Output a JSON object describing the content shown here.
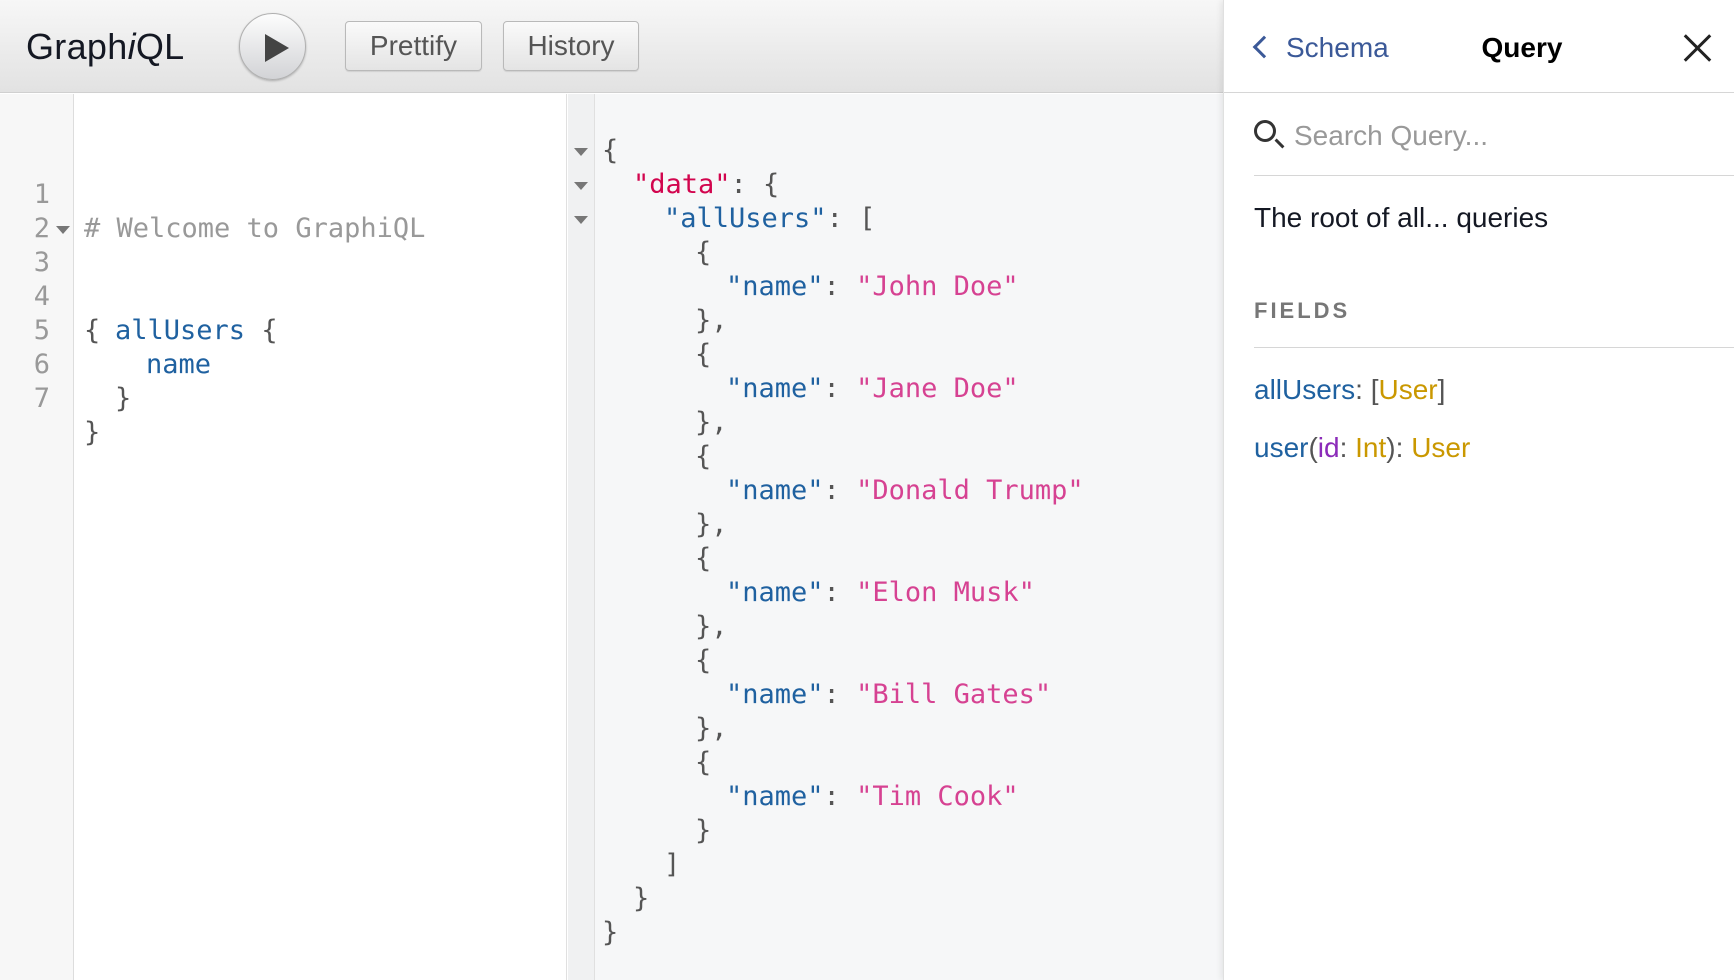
{
  "toolbar": {
    "title_prefix": "Graph",
    "title_italic": "i",
    "title_suffix": "QL",
    "run_icon": "play-icon",
    "prettify_label": "Prettify",
    "history_label": "History"
  },
  "query_editor": {
    "lines": [
      {
        "num": "1",
        "comment": "# Welcome to GraphiQL"
      },
      {
        "num": "2"
      },
      {
        "num": "3",
        "punct": "{"
      },
      {
        "num": "4",
        "field": "allUsers",
        "punct": "{"
      },
      {
        "num": "5",
        "field": "name"
      },
      {
        "num": "6",
        "punct": "}"
      },
      {
        "num": "7",
        "punct": "}"
      }
    ]
  },
  "result": {
    "data_key": "\"data\"",
    "all_users_key": "\"allUsers\"",
    "name_key": "\"name\"",
    "names": [
      "\"John Doe\"",
      "\"Jane Doe\"",
      "\"Donald Trump\"",
      "\"Elon Musk\"",
      "\"Bill Gates\"",
      "\"Tim Cook\""
    ]
  },
  "docs": {
    "back_label": "Schema",
    "title": "Query",
    "close_icon": "close-icon",
    "search_placeholder": "Search Query...",
    "description": "The root of all... queries",
    "fields_heading": "FIELDS",
    "fields": [
      {
        "name": "allUsers",
        "type": "User"
      },
      {
        "name": "user",
        "arg_name": "id",
        "arg_type": "Int",
        "type": "User"
      }
    ]
  },
  "colors": {
    "field_name": "#1f61a0",
    "type_name": "#ca9800",
    "arg_name": "#8b2bb9",
    "json_string": "#d64292",
    "data_key": "#d2054e",
    "comment": "#999999"
  }
}
